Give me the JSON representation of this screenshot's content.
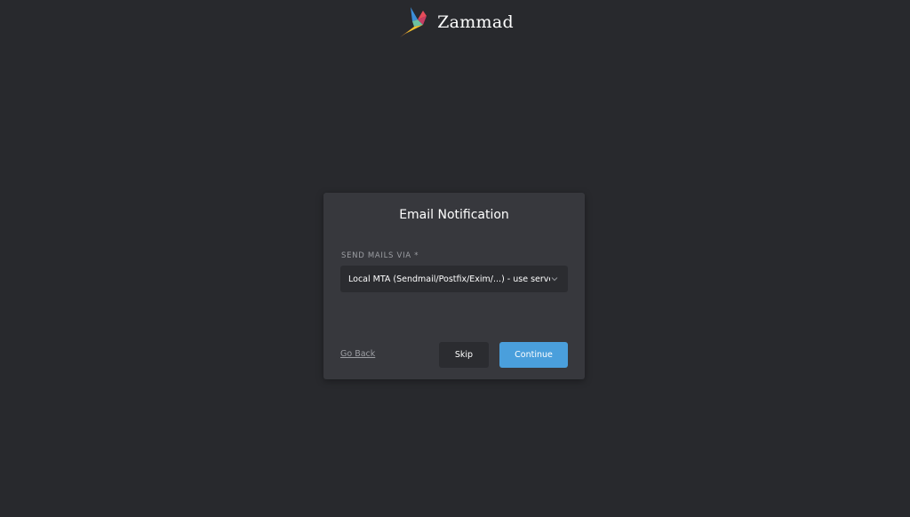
{
  "header": {
    "logo_icon": "zammad-bird-icon",
    "logo_text": "Zammad"
  },
  "modal": {
    "title": "Email Notification",
    "field_label": "SEND MAILS VIA *",
    "select_value": "Local MTA (Sendmail/Postfix/Exim/...) - use server setup",
    "select_icon": "chevron-down-icon",
    "go_back_label": "Go Back",
    "skip_label": "Skip",
    "continue_label": "Continue"
  },
  "colors": {
    "background": "#28292d",
    "modal": "#37383d",
    "accent": "#4a9fdc"
  }
}
